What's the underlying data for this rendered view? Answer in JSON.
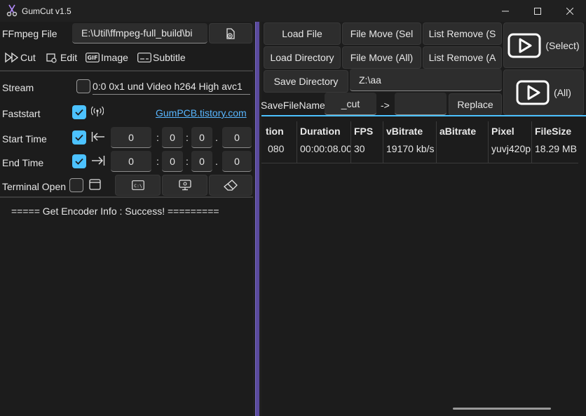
{
  "window": {
    "title": "GumCut v1.5"
  },
  "left": {
    "ffmpeg_label": "FFmpeg File",
    "ffmpeg_path": "E:\\Util\\ffmpeg-full_build\\bi",
    "tabs": [
      {
        "label": "Cut",
        "icon": "cut-icon"
      },
      {
        "label": "Edit",
        "icon": "edit-icon"
      },
      {
        "label": "Image",
        "icon": "gif-icon"
      },
      {
        "label": "Subtitle",
        "icon": "subtitle-icon"
      }
    ],
    "stream_label": "Stream",
    "stream_value": "0:0 0x1 und Video h264 High avc1",
    "faststart_label": "Faststart",
    "link_text": "GumPCB.tistory.com",
    "start_time_label": "Start Time",
    "end_time_label": "End Time",
    "start_time": [
      "0",
      "0",
      "0",
      "0"
    ],
    "end_time": [
      "0",
      "0",
      "0",
      "0"
    ],
    "time_seps": [
      ":",
      ":",
      "."
    ],
    "terminal_label": "Terminal Open",
    "log_text": "===== Get Encoder Info : Success! ========="
  },
  "right": {
    "load_file": "Load File",
    "file_move_sel": "File Move (Sel",
    "list_remove_sel": "List Remove (S",
    "run_select": "(Select)",
    "load_directory": "Load Directory",
    "file_move_all": "File Move (All)",
    "list_remove_all": "List Remove (A",
    "run_all": "(All)",
    "save_directory": "Save Directory",
    "save_dir_value": "Z:\\aa",
    "savefilename_label": "SaveFileName",
    "suffix": "_cut",
    "arrow": "->",
    "replace_value": "",
    "replace_label": "Replace"
  },
  "table": {
    "headers": [
      "tion",
      "Duration",
      "FPS",
      "vBitrate",
      "aBitrate",
      "Pixel",
      "FileSize"
    ],
    "rows": [
      [
        "080",
        "00:00:08.00",
        "30",
        "19170 kb/s",
        "",
        "yuvj420p",
        "18.29 MB"
      ]
    ]
  },
  "colors": {
    "accent": "#4cc2ff",
    "splitter": "#5a4a9e",
    "link": "#58b6ff"
  }
}
